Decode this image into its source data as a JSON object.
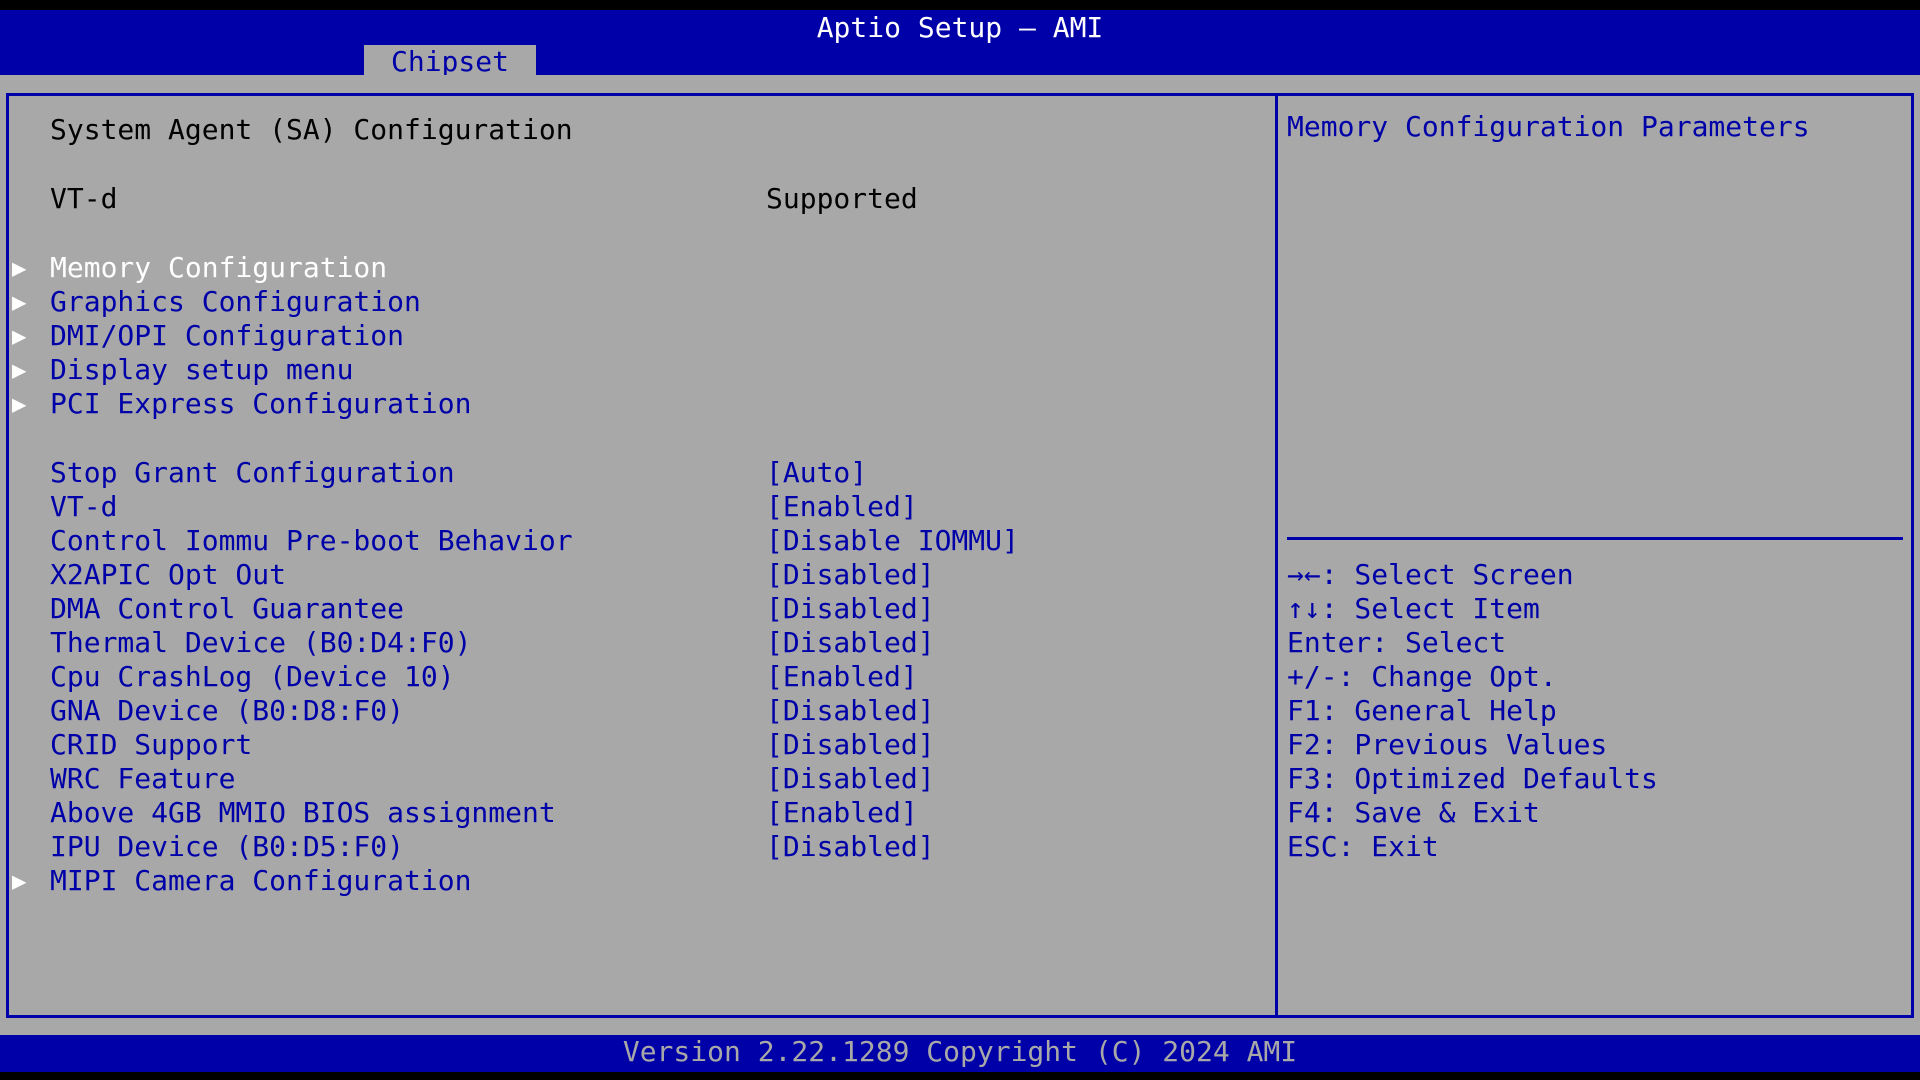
{
  "header": {
    "title": "Aptio Setup – AMI",
    "active_tab": "Chipset"
  },
  "main": {
    "section_title": "System Agent (SA) Configuration",
    "info": {
      "label": "VT-d",
      "value": "Supported"
    },
    "submenus": [
      "Memory Configuration",
      "Graphics Configuration",
      "DMI/OPI Configuration",
      "Display setup menu",
      "PCI Express Configuration"
    ],
    "settings": [
      {
        "label": "Stop Grant Configuration",
        "value": "[Auto]"
      },
      {
        "label": "VT-d",
        "value": "[Enabled]"
      },
      {
        "label": "Control Iommu Pre-boot Behavior",
        "value": "[Disable IOMMU]"
      },
      {
        "label": "X2APIC Opt Out",
        "value": "[Disabled]"
      },
      {
        "label": "DMA Control Guarantee",
        "value": "[Disabled]"
      },
      {
        "label": "Thermal Device (B0:D4:F0)",
        "value": "[Disabled]"
      },
      {
        "label": "Cpu CrashLog (Device 10)",
        "value": "[Enabled]"
      },
      {
        "label": "GNA Device (B0:D8:F0)",
        "value": "[Disabled]"
      },
      {
        "label": "CRID Support",
        "value": "[Disabled]"
      },
      {
        "label": "WRC Feature",
        "value": "[Disabled]"
      },
      {
        "label": "Above 4GB MMIO BIOS assignment",
        "value": "[Enabled]"
      },
      {
        "label": "IPU Device (B0:D5:F0)",
        "value": "[Disabled]"
      }
    ],
    "last_submenu": "MIPI Camera Configuration",
    "arrow_glyph": "▶"
  },
  "help": {
    "description": "Memory Configuration Parameters",
    "keys": [
      "→←: Select Screen",
      "↑↓: Select Item",
      "Enter: Select",
      "+/-: Change Opt.",
      "F1: General Help",
      "F2: Previous Values",
      "F3: Optimized Defaults",
      "F4: Save & Exit",
      "ESC: Exit"
    ]
  },
  "footer": {
    "text": "Version 2.22.1289 Copyright (C) 2024 AMI"
  },
  "colors": {
    "bios_blue": "#0000A8",
    "bios_gray": "#A8A8A8",
    "highlight": "#FFFFFF",
    "text": "#000000"
  }
}
